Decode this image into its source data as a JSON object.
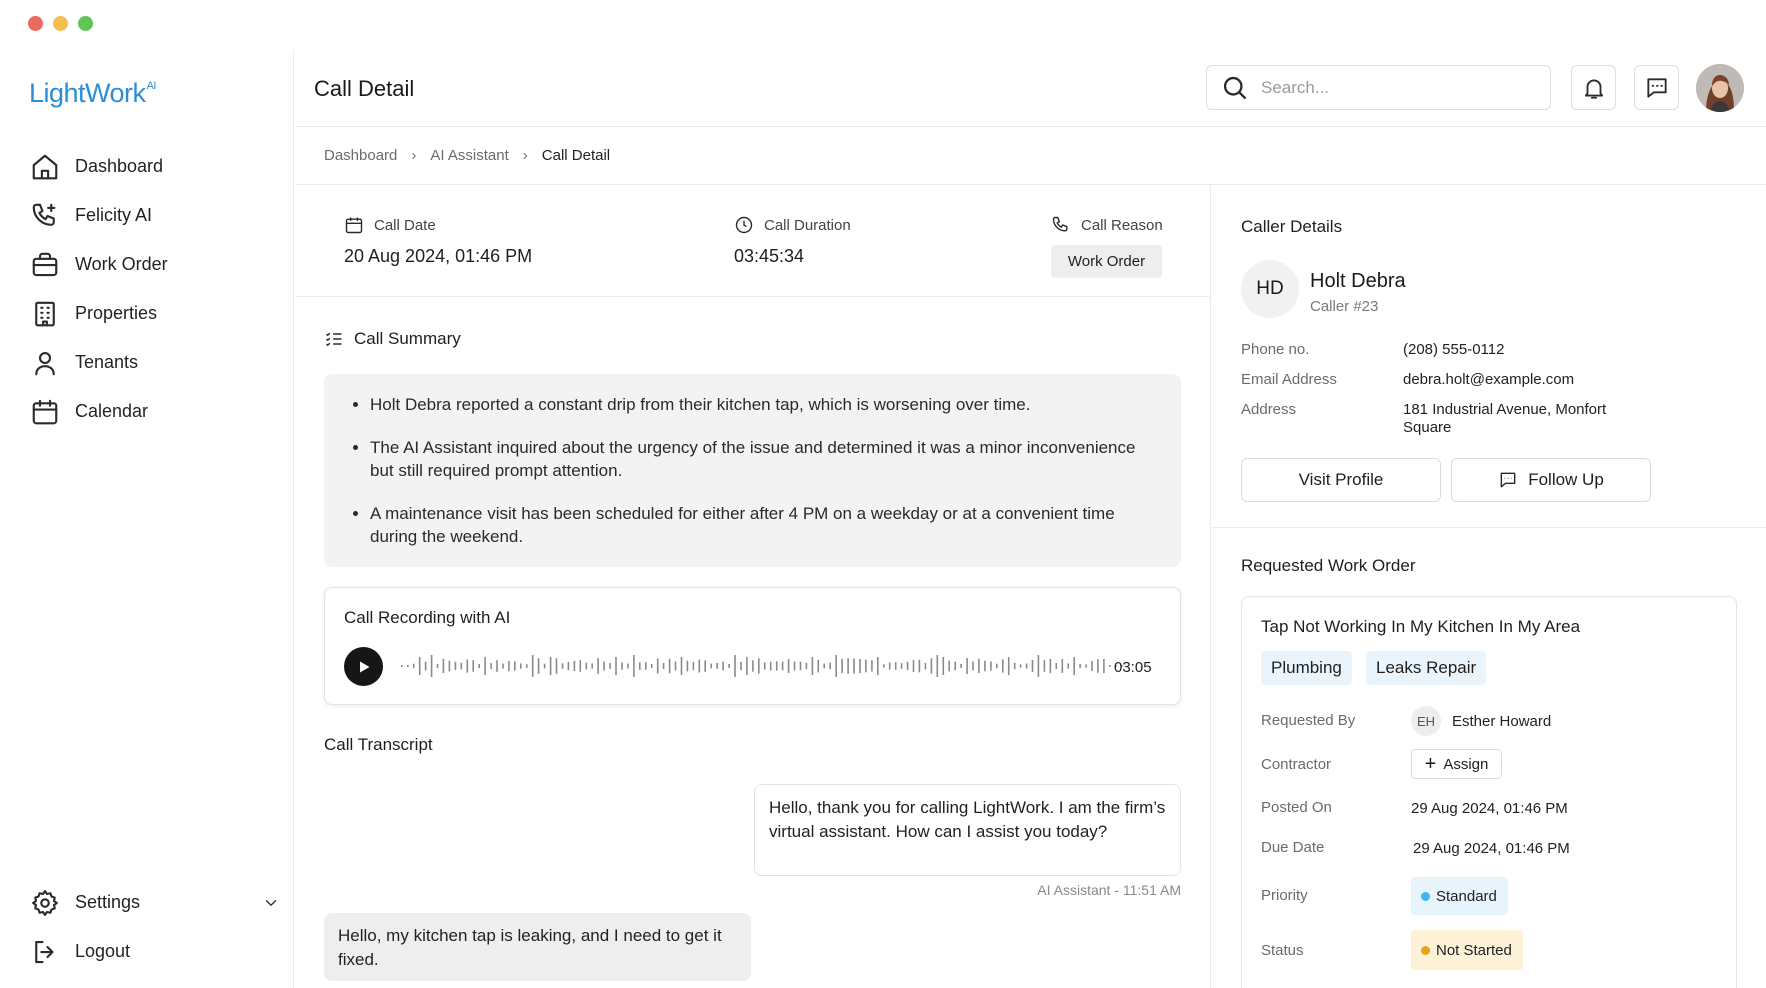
{
  "app": {
    "logo": "LightWork",
    "logo_sup": "AI"
  },
  "sidebar": {
    "items": [
      {
        "label": "Dashboard",
        "icon": "home-icon"
      },
      {
        "label": "Felicity AI",
        "icon": "phone-sparkle-icon"
      },
      {
        "label": "Work Order",
        "icon": "briefcase-icon"
      },
      {
        "label": "Properties",
        "icon": "building-icon"
      },
      {
        "label": "Tenants",
        "icon": "user-icon"
      },
      {
        "label": "Calendar",
        "icon": "calendar-icon"
      }
    ],
    "settings": "Settings",
    "logout": "Logout"
  },
  "header": {
    "title": "Call Detail",
    "search_placeholder": "Search..."
  },
  "breadcrumb": [
    "Dashboard",
    "AI Assistant",
    "Call Detail"
  ],
  "call": {
    "date_label": "Call Date",
    "date_value": "20 Aug 2024, 01:46 PM",
    "duration_label": "Call Duration",
    "duration_value": "03:45:34",
    "reason_label": "Call Reason",
    "reason_value": "Work Order"
  },
  "summary": {
    "title": "Call Summary",
    "items": [
      "Holt Debra reported a constant drip from their kitchen tap, which is worsening over time.",
      "The AI Assistant inquired about the urgency of the issue and determined it was a minor inconvenience but still required prompt attention.",
      "A maintenance visit has been scheduled for either after 4 PM on a weekday or at a convenient time during the weekend."
    ]
  },
  "recording": {
    "title": "Call Recording with AI",
    "time": "03:05"
  },
  "transcript": {
    "title": "Call Transcript",
    "ai_message": "Hello, thank you for calling LightWork. I am the firm’s virtual assistant. How can I assist you today?",
    "ai_meta": "AI Assistant - 11:51 AM",
    "user_message": "Hello, my kitchen tap is leaking, and I need to get it fixed."
  },
  "caller": {
    "section_title": "Caller Details",
    "initials": "HD",
    "name": "Holt Debra",
    "number": "Caller #23",
    "phone_label": "Phone no.",
    "phone": "(208) 555-0112",
    "email_label": "Email Address",
    "email": "debra.holt@example.com",
    "address_label": "Address",
    "address": "181 Industrial Avenue, Monfort Square",
    "visit_profile": "Visit Profile",
    "follow_up": "Follow Up"
  },
  "work_order": {
    "section_title": "Requested Work Order",
    "title": "Tap Not Working In My Kitchen In My Area",
    "tags": [
      "Plumbing",
      "Leaks Repair"
    ],
    "requested_by_label": "Requested By",
    "requested_by_initials": "EH",
    "requested_by": "Esther Howard",
    "contractor_label": "Contractor",
    "assign": "Assign",
    "posted_on_label": "Posted On",
    "posted_on": "29 Aug 2024, 01:46 PM",
    "due_date_label": "Due Date",
    "due_date": "29 Aug 2024, 01:46 PM",
    "priority_label": "Priority",
    "priority": "Standard",
    "status_label": "Status",
    "status": "Not Started"
  },
  "colors": {
    "brand": "#2a8fd6",
    "tag_bg": "#e9f4fc",
    "priority_bg": "#e8f4fb",
    "priority_dot": "#3fb6ee",
    "status_bg": "#fdf1d8",
    "status_dot": "#e8a317"
  }
}
